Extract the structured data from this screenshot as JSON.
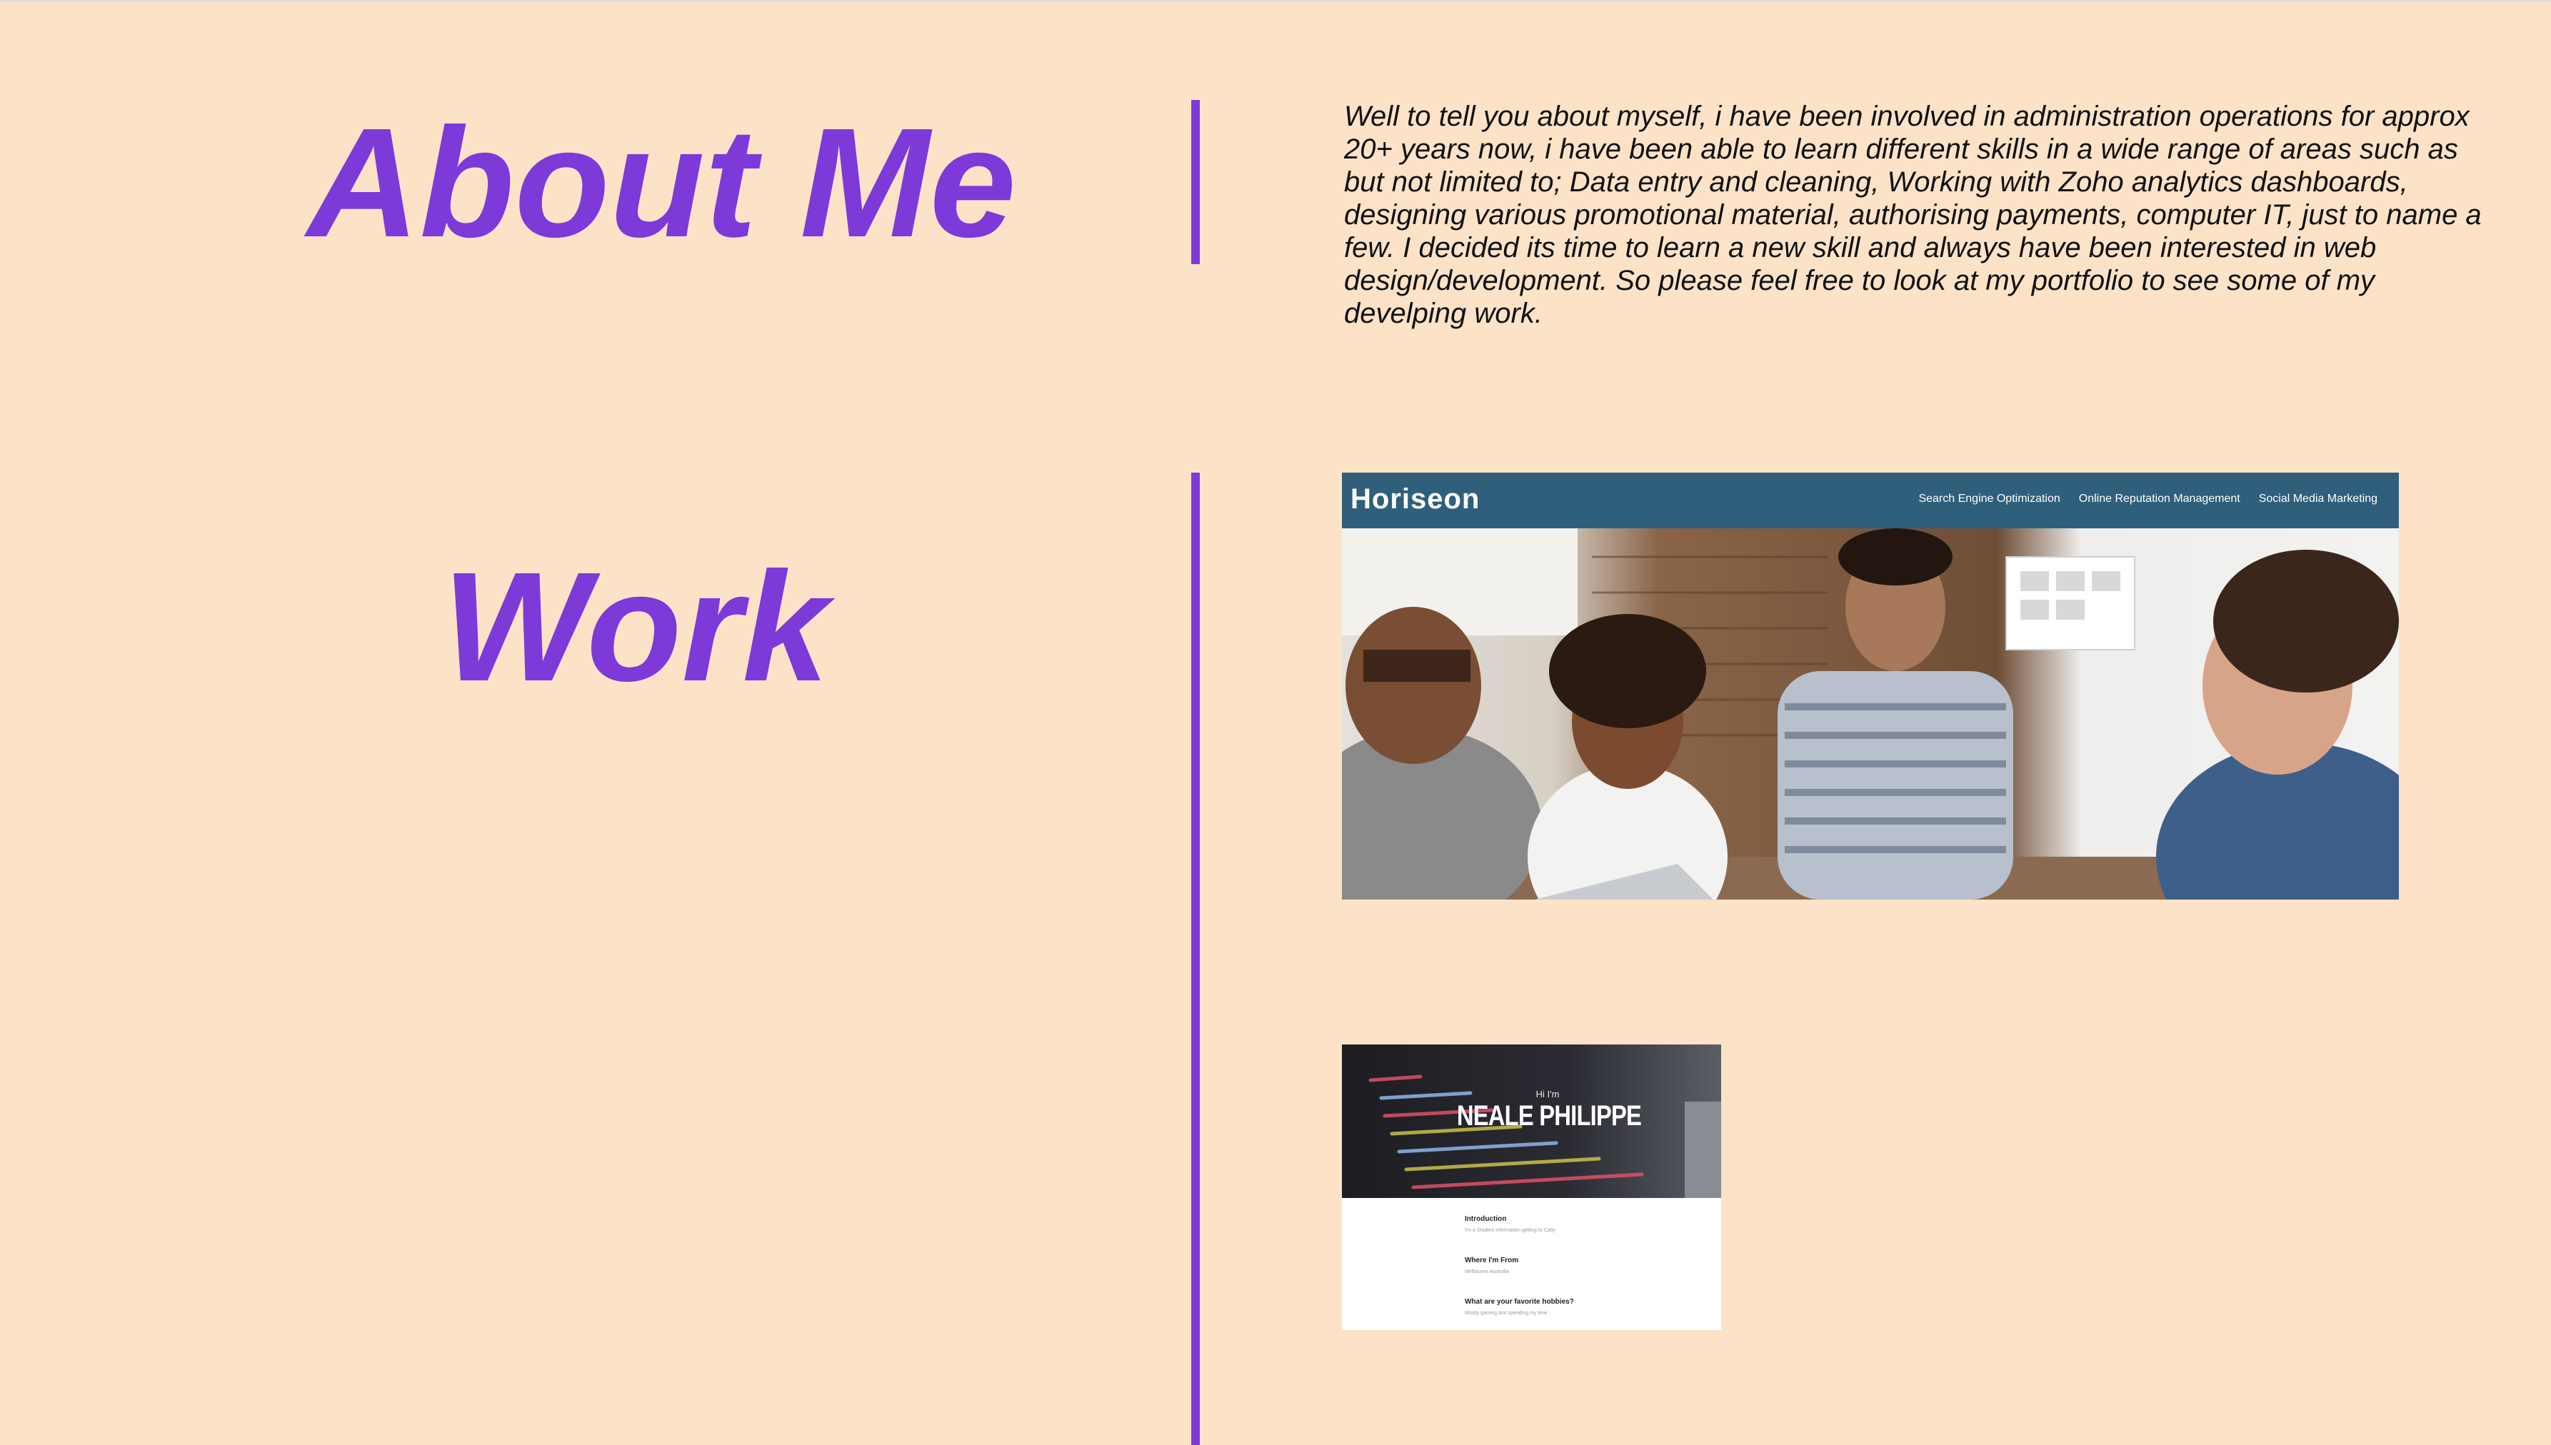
{
  "about": {
    "heading": "About Me",
    "text": "Well to tell you about myself, i have been involved in administration operations for approx 20+ years now, i have been able to learn different skills in a wide range of areas such as but not limited to; Data entry and cleaning, Working with Zoho analytics dashboards, designing various promotional material, authorising payments, computer IT, just to name a few. I decided its time to learn a new skill and always have been interested in web design/development. So please feel free to look at my portfolio to see some of my develping work."
  },
  "work": {
    "heading": "Work",
    "projects": [
      {
        "logo": "Horiseon",
        "nav": [
          "Search Engine Optimization",
          "Online Reputation Management",
          "Social Media Marketing"
        ]
      },
      {
        "greeting": "Hi I'm",
        "name": "NEALE PHILIPPE",
        "sections": [
          {
            "heading": "Introduction",
            "text": "I'm a Student Information getting to Catty"
          },
          {
            "heading": "Where I'm From",
            "text": "Melbourne Australia"
          },
          {
            "heading": "What are your favorite hobbies?",
            "text": "Mostly gaming and spending my time"
          }
        ]
      }
    ]
  },
  "colors": {
    "background": "#fce3c8",
    "accent": "#7d3ad8",
    "text": "#111111",
    "horiseon_header": "#2f5f7b"
  }
}
